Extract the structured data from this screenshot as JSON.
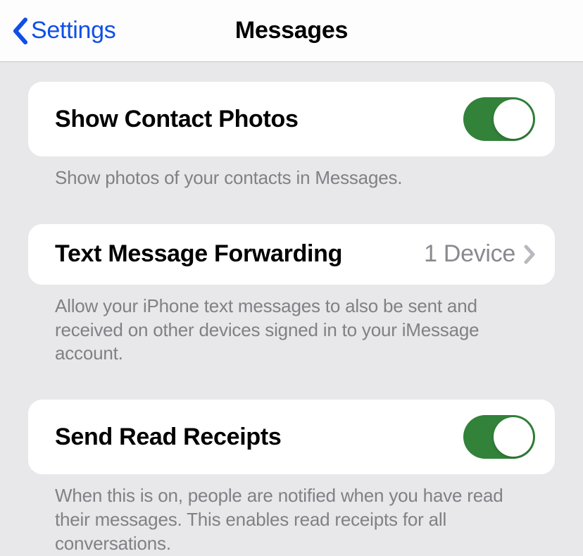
{
  "nav": {
    "back_label": "Settings",
    "title": "Messages"
  },
  "groups": [
    {
      "label": "Show Contact Photos",
      "type": "toggle",
      "value": true,
      "footer": "Show photos of your contacts in Messages."
    },
    {
      "label": "Text Message Forwarding",
      "type": "nav",
      "value": "1 Device",
      "footer": "Allow your iPhone text messages to also be sent and received on other devices signed in to your iMessage account."
    },
    {
      "label": "Send Read Receipts",
      "type": "toggle",
      "value": true,
      "footer": "When this is on, people are notified when you have read their messages. This enables read receipts for all conversations."
    }
  ]
}
